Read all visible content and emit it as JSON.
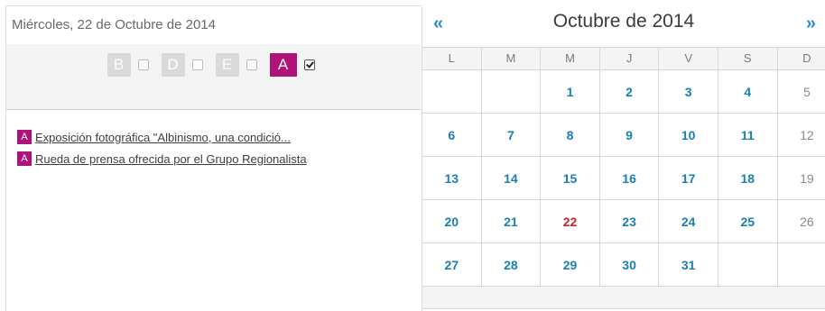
{
  "left": {
    "date": "Miércoles, 22 de Octubre de 2014",
    "filters": [
      {
        "letter": "B",
        "active": false
      },
      {
        "letter": "D",
        "active": false
      },
      {
        "letter": "E",
        "active": false
      },
      {
        "letter": "A",
        "active": true
      }
    ],
    "events": [
      {
        "badge": "A",
        "title": "Exposición fotográfica \"Albinismo, una condició..."
      },
      {
        "badge": "A",
        "title": "Rueda de prensa ofrecida por el Grupo Regionalista"
      }
    ]
  },
  "calendar": {
    "title": "Octubre de 2014",
    "prev": "«",
    "next": "»",
    "weekdays": [
      "L",
      "M",
      "M",
      "J",
      "V",
      "S",
      "D"
    ],
    "today": 22,
    "weeks": [
      [
        "",
        "",
        "1",
        "2",
        "3",
        "4",
        "5"
      ],
      [
        "6",
        "7",
        "8",
        "9",
        "10",
        "11",
        "12"
      ],
      [
        "13",
        "14",
        "15",
        "16",
        "17",
        "18",
        "19"
      ],
      [
        "20",
        "21",
        "22",
        "23",
        "24",
        "25",
        "26"
      ],
      [
        "27",
        "28",
        "29",
        "30",
        "31",
        "",
        ""
      ]
    ]
  },
  "colors": {
    "accent": "#b0127a",
    "link": "#1a7fb5",
    "today": "#c4242f"
  }
}
